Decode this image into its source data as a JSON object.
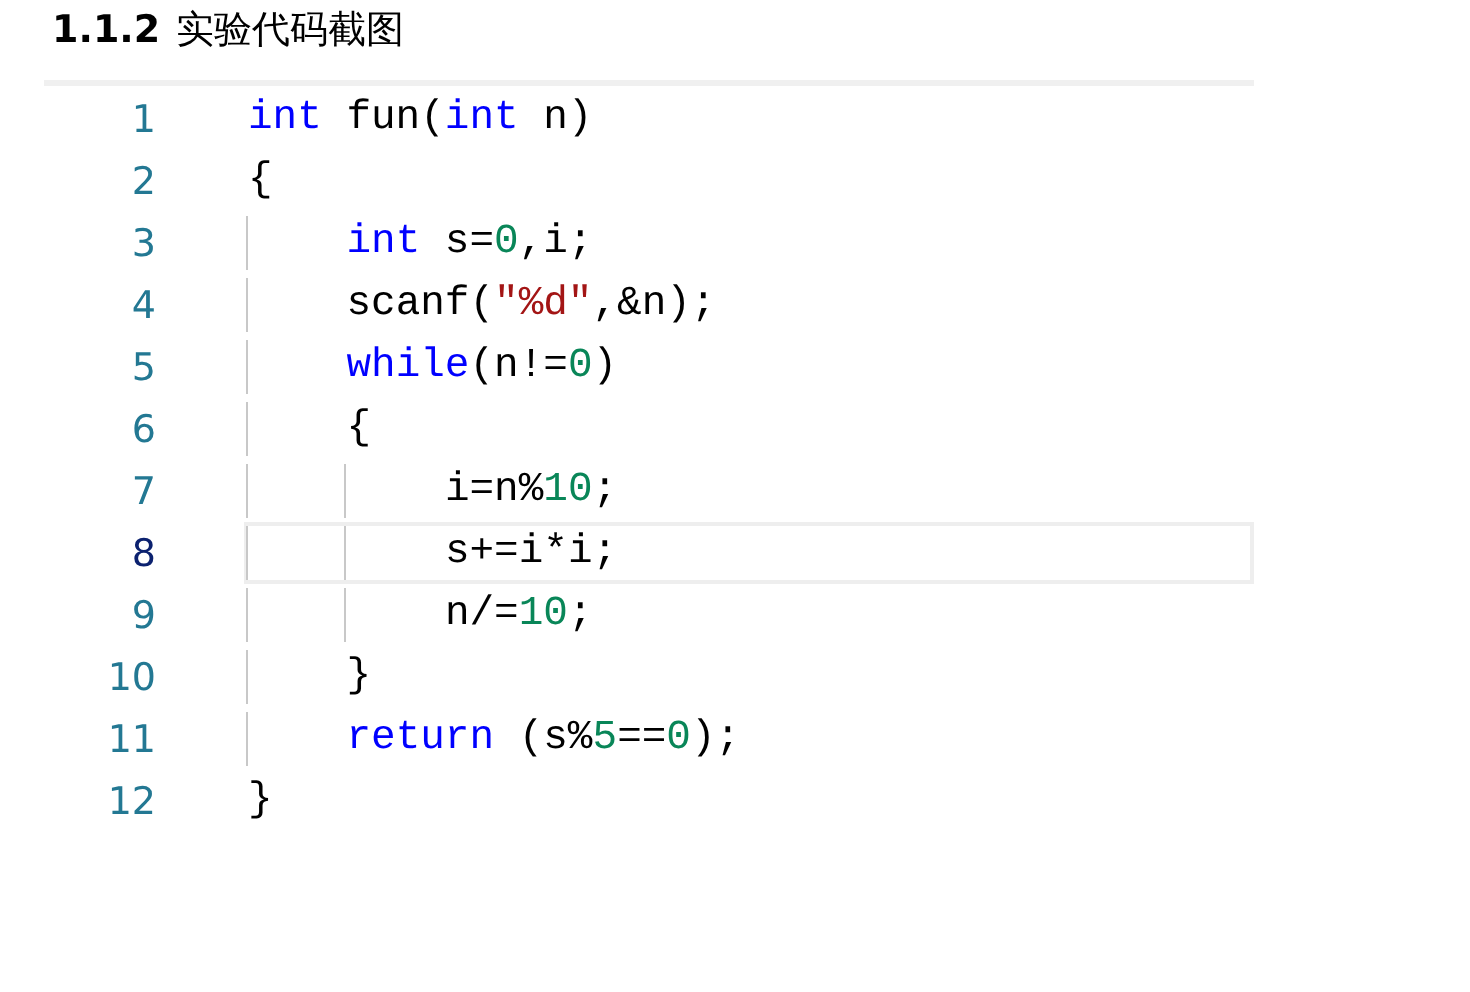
{
  "heading": {
    "number": "1.1.2",
    "title": "实验代码截图"
  },
  "code_lines": [
    {
      "number": "1",
      "current": false,
      "tokens": [
        {
          "kind": "keyword",
          "text": "int"
        },
        {
          "kind": "plain",
          "text": " fun("
        },
        {
          "kind": "keyword",
          "text": "int"
        },
        {
          "kind": "plain",
          "text": " n)"
        }
      ]
    },
    {
      "number": "2",
      "current": false,
      "tokens": [
        {
          "kind": "plain",
          "text": "{"
        }
      ]
    },
    {
      "number": "3",
      "current": false,
      "tokens": [
        {
          "kind": "keyword",
          "text": "    int"
        },
        {
          "kind": "plain",
          "text": " s="
        },
        {
          "kind": "number",
          "text": "0"
        },
        {
          "kind": "plain",
          "text": ",i;"
        }
      ]
    },
    {
      "number": "4",
      "current": false,
      "tokens": [
        {
          "kind": "plain",
          "text": "    scanf("
        },
        {
          "kind": "string",
          "text": "\"%d\""
        },
        {
          "kind": "plain",
          "text": ",&n);"
        }
      ]
    },
    {
      "number": "5",
      "current": false,
      "tokens": [
        {
          "kind": "keyword",
          "text": "    while"
        },
        {
          "kind": "plain",
          "text": "(n!="
        },
        {
          "kind": "number",
          "text": "0"
        },
        {
          "kind": "plain",
          "text": ")"
        }
      ]
    },
    {
      "number": "6",
      "current": false,
      "tokens": [
        {
          "kind": "plain",
          "text": "    {"
        }
      ]
    },
    {
      "number": "7",
      "current": false,
      "tokens": [
        {
          "kind": "plain",
          "text": "        i=n%"
        },
        {
          "kind": "number",
          "text": "10"
        },
        {
          "kind": "plain",
          "text": ";"
        }
      ]
    },
    {
      "number": "8",
      "current": true,
      "tokens": [
        {
          "kind": "plain",
          "text": "        s+=i*i;"
        }
      ]
    },
    {
      "number": "9",
      "current": false,
      "tokens": [
        {
          "kind": "plain",
          "text": "        n/="
        },
        {
          "kind": "number",
          "text": "10"
        },
        {
          "kind": "plain",
          "text": ";"
        }
      ]
    },
    {
      "number": "10",
      "current": false,
      "tokens": [
        {
          "kind": "plain",
          "text": "    }"
        }
      ]
    },
    {
      "number": "11",
      "current": false,
      "tokens": [
        {
          "kind": "keyword",
          "text": "    return"
        },
        {
          "kind": "plain",
          "text": " (s%"
        },
        {
          "kind": "number",
          "text": "5"
        },
        {
          "kind": "plain",
          "text": "=="
        },
        {
          "kind": "number",
          "text": "0"
        },
        {
          "kind": "plain",
          "text": ");"
        }
      ]
    },
    {
      "number": "12",
      "current": false,
      "tokens": [
        {
          "kind": "plain",
          "text": "}"
        }
      ]
    }
  ]
}
